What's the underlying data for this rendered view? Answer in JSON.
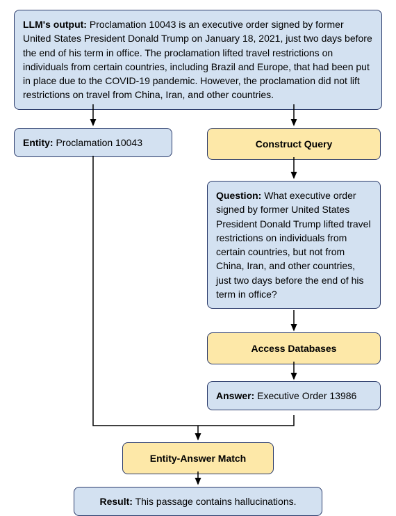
{
  "top": {
    "label": "LLM's output:",
    "text": " Proclamation 10043 is an executive order signed by former United States President Donald Trump on January 18, 2021, just two days before the end of his term in office. The proclamation lifted travel restrictions on individuals from certain countries, including Brazil and Europe, that had been put in place due to the COVID-19 pandemic. However, the proclamation did not lift restrictions on travel from China, Iran, and other countries."
  },
  "entity": {
    "label": "Entity:",
    "value": " Proclamation 10043"
  },
  "construct_query": "Construct Query",
  "question": {
    "label": "Question:",
    "text": " What executive order signed by former United States President Donald Trump lifted travel restrictions on individuals from certain countries, but not from China, Iran, and other countries, just two days before the end of his term in office?"
  },
  "access_db": "Access Databases",
  "answer": {
    "label": "Answer:",
    "value": " Executive Order 13986"
  },
  "match": "Entity-Answer Match",
  "result": {
    "label": "Result:",
    "text": " This passage contains hallucinations."
  }
}
